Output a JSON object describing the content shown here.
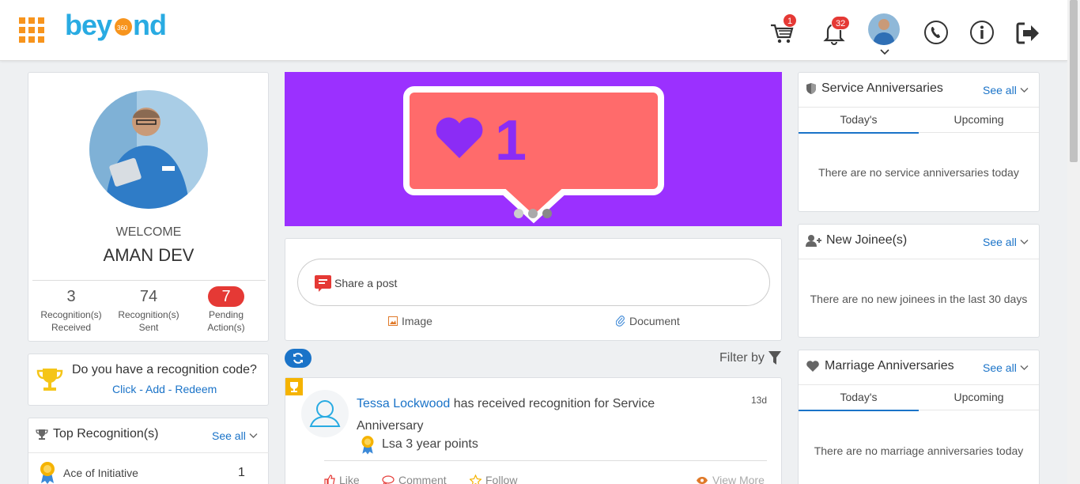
{
  "header": {
    "logo_text": "beyond",
    "logo_sub": "360",
    "cart_badge": "1",
    "notif_badge": "32"
  },
  "profile": {
    "welcome": "WELCOME",
    "name": "AMAN DEV",
    "stats": [
      {
        "value": "3",
        "label1": "Recognition(s)",
        "label2": "Received"
      },
      {
        "value": "74",
        "label1": "Recognition(s)",
        "label2": "Sent"
      },
      {
        "value": "7",
        "label1": "Pending",
        "label2": "Action(s)"
      }
    ]
  },
  "code_card": {
    "question": "Do you have a recognition code?",
    "link": "Click - Add - Redeem"
  },
  "top_recognition": {
    "title": "Top Recognition(s)",
    "see_all": "See all",
    "items": [
      {
        "name": "Ace of Initiative",
        "count": "1"
      }
    ]
  },
  "banner": {
    "heart_count": "1"
  },
  "composer": {
    "placeholder": "Share a post",
    "image": "Image",
    "document": "Document"
  },
  "feed": {
    "filter": "Filter by",
    "post": {
      "person": "Tessa Lockwood",
      "text_line1": " has received recognition for Service",
      "text_line2": "Anniversary",
      "time": "13d",
      "award": "Lsa 3 year points",
      "like": "Like",
      "comment": "Comment",
      "follow": "Follow",
      "view_more": "View More"
    }
  },
  "service": {
    "title": "Service Anniversaries",
    "see_all": "See all",
    "tab1": "Today's",
    "tab2": "Upcoming",
    "empty": "There are no service anniversaries today"
  },
  "joinee": {
    "title": "New Joinee(s)",
    "see_all": "See all",
    "empty": "There are no new joinees in the last 30 days"
  },
  "marriage": {
    "title": "Marriage Anniversaries",
    "see_all": "See all",
    "tab1": "Today's",
    "tab2": "Upcoming",
    "empty": "There are no marriage anniversaries today"
  },
  "colors": {
    "accent": "#1a73c8",
    "brand_orange": "#f7941d",
    "banner_bg": "#9b30ff",
    "badge": "#e53935"
  }
}
